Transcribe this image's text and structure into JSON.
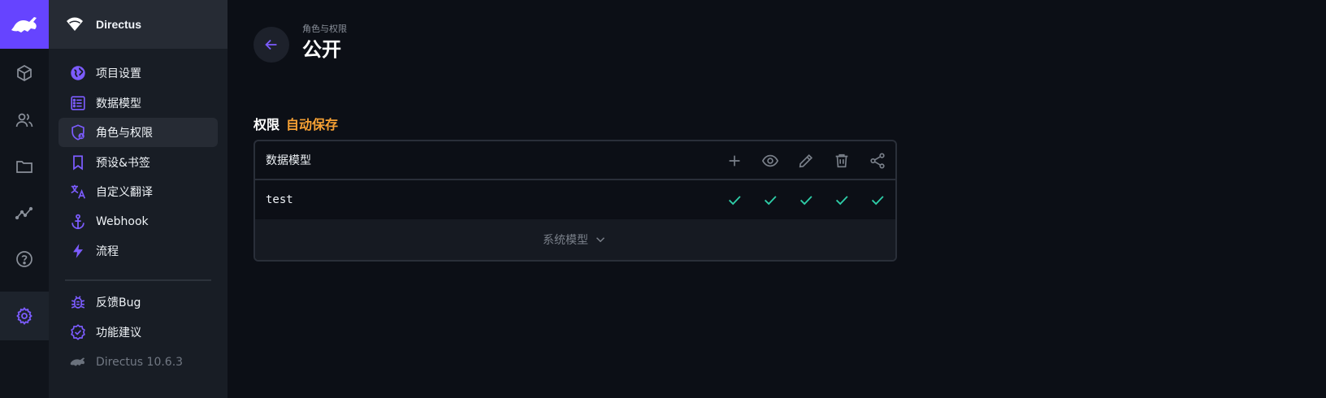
{
  "project": {
    "name": "Directus"
  },
  "nav": {
    "items": [
      {
        "label": "项目设置",
        "icon": "globe-icon"
      },
      {
        "label": "数据模型",
        "icon": "list-alt-icon"
      },
      {
        "label": "角色与权限",
        "icon": "shield-user-icon"
      },
      {
        "label": "预设&书签",
        "icon": "bookmark-icon"
      },
      {
        "label": "自定义翻译",
        "icon": "translate-icon"
      },
      {
        "label": "Webhook",
        "icon": "anchor-icon"
      },
      {
        "label": "流程",
        "icon": "bolt-icon"
      }
    ],
    "secondary": [
      {
        "label": "反馈Bug",
        "icon": "bug-icon"
      },
      {
        "label": "功能建议",
        "icon": "verified-icon"
      },
      {
        "label": "Directus 10.6.3",
        "icon": "directus-logo-icon"
      }
    ]
  },
  "modules": [
    "content-icon",
    "users-icon",
    "files-icon",
    "insights-icon",
    "help-icon",
    "settings-icon"
  ],
  "header": {
    "breadcrumb": "角色与权限",
    "title": "公开"
  },
  "permissions": {
    "heading": "权限",
    "autosave": "自动保存",
    "column_header": "数据模型",
    "actions": [
      "create-icon",
      "read-icon",
      "update-icon",
      "delete-icon",
      "share-icon"
    ],
    "rows": [
      {
        "name": "test"
      }
    ],
    "system_toggle": "系统模型"
  },
  "colors": {
    "accent": "#6644ff",
    "autosave": "#f7a134",
    "check": "#2ecda7"
  }
}
